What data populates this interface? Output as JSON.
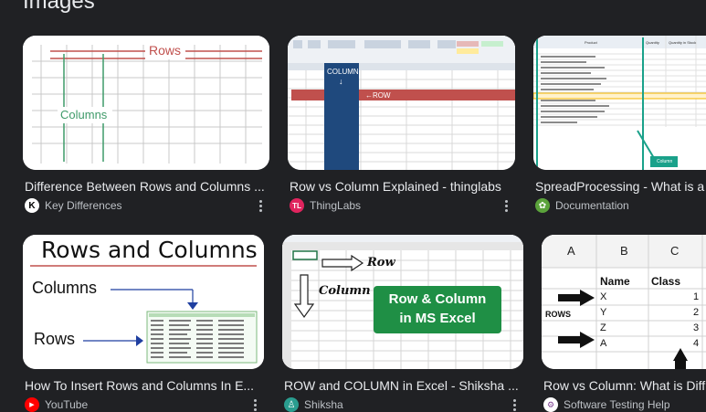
{
  "section": {
    "title": "Images"
  },
  "results": [
    {
      "caption": "Difference Between Rows and Columns ...",
      "source": "Key Differences",
      "thumb_text": [
        "Rows",
        "Columns"
      ]
    },
    {
      "caption": "Row vs Column Explained - thinglabs",
      "source": "ThingLabs",
      "thumb_text": [
        "COLUMN",
        "↓",
        "←ROW"
      ]
    },
    {
      "caption": "SpreadProcessing - What is a",
      "source": "Documentation",
      "thumb_text": [
        "Product",
        "Quantity",
        "Quantity in Stock",
        "Column"
      ]
    },
    {
      "caption": "How To Insert Rows and Columns In E...",
      "source": "YouTube",
      "thumb_text": [
        "Rows and Columns",
        "Columns",
        "Rows"
      ]
    },
    {
      "caption": "ROW and COLUMN in Excel - Shiksha ...",
      "source": "Shiksha",
      "thumb_text": [
        "Row",
        "Column",
        "Row & Column",
        "in MS Excel"
      ]
    },
    {
      "caption": "Row vs Column: What is Diff",
      "source": "Software Testing Help",
      "thumb_text": [
        "A",
        "B",
        "C",
        "Name",
        "Class",
        "X",
        "Y",
        "Z",
        "A",
        "1",
        "2",
        "3",
        "4",
        "ROWS"
      ]
    }
  ]
}
